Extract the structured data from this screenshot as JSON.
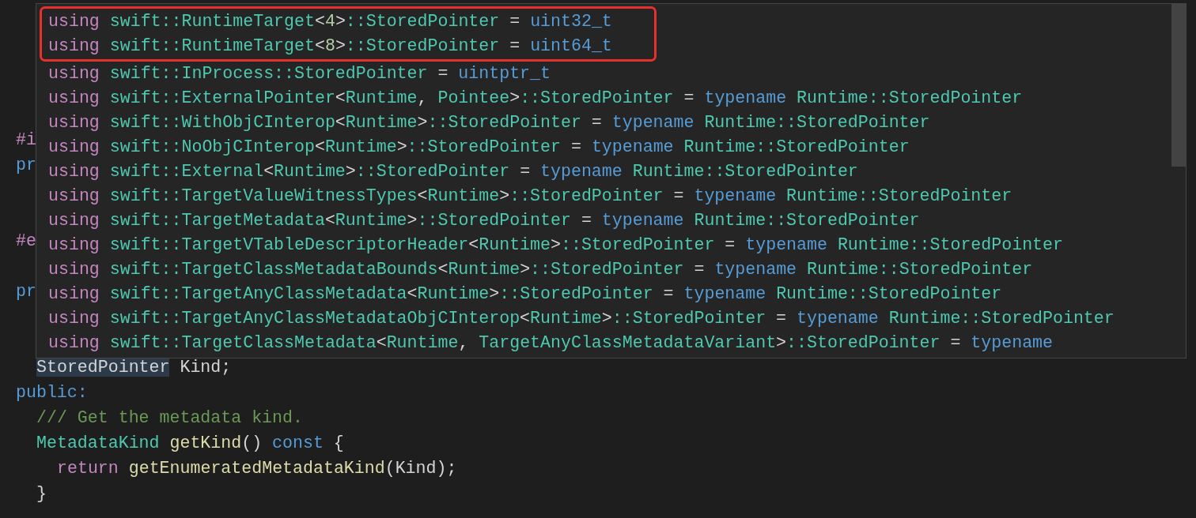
{
  "editor": {
    "lines": [
      {
        "kind": "blank"
      },
      {
        "kind": "blank"
      },
      {
        "kind": "blank"
      },
      {
        "kind": "blank"
      },
      {
        "kind": "blank"
      },
      {
        "kind": "outer",
        "tokens": [
          {
            "kind": "directive",
            "text": "#i"
          }
        ]
      },
      {
        "kind": "outer",
        "tokens": [
          {
            "kind": "storage",
            "text": "pr"
          }
        ]
      },
      {
        "kind": "blank"
      },
      {
        "kind": "blank"
      },
      {
        "kind": "outer",
        "tokens": [
          {
            "kind": "directive",
            "text": "#e"
          }
        ]
      },
      {
        "kind": "blank"
      },
      {
        "kind": "outer",
        "tokens": [
          {
            "kind": "storage",
            "text": "pr"
          }
        ]
      },
      {
        "kind": "blank"
      },
      {
        "kind": "blank"
      },
      {
        "kind": "inner",
        "tokens": [
          {
            "kind": "plain",
            "text": "StoredPointer",
            "highlighted": true
          },
          {
            "kind": "plain",
            "text": " Kind;"
          }
        ]
      },
      {
        "kind": "outer",
        "tokens": [
          {
            "kind": "storage",
            "text": "public:"
          }
        ]
      },
      {
        "kind": "inner",
        "tokens": [
          {
            "kind": "comment",
            "text": "/// Get the metadata kind."
          }
        ]
      },
      {
        "kind": "inner",
        "tokens": [
          {
            "kind": "type",
            "text": "MetadataKind"
          },
          {
            "kind": "function",
            "text": " getKind"
          },
          {
            "kind": "plain",
            "text": "() "
          },
          {
            "kind": "storage",
            "text": "const"
          },
          {
            "kind": "plain",
            "text": " {"
          }
        ]
      },
      {
        "kind": "deep",
        "tokens": [
          {
            "kind": "keyword",
            "text": "return"
          },
          {
            "kind": "function",
            "text": " getEnumeratedMetadataKind"
          },
          {
            "kind": "plain",
            "text": "(Kind);"
          }
        ]
      },
      {
        "kind": "inner",
        "tokens": [
          {
            "kind": "plain",
            "text": "}"
          }
        ]
      }
    ]
  },
  "popup": {
    "lines": [
      {
        "highlighted": true,
        "tokens": [
          {
            "kind": "keyword",
            "text": "using"
          },
          {
            "kind": "type",
            "text": " swift::RuntimeTarget"
          },
          {
            "kind": "plain",
            "text": "<"
          },
          {
            "kind": "number",
            "text": "4"
          },
          {
            "kind": "plain",
            "text": ">"
          },
          {
            "kind": "type",
            "text": "::StoredPointer"
          },
          {
            "kind": "plain",
            "text": " = "
          },
          {
            "kind": "storage",
            "text": "uint32_t"
          }
        ]
      },
      {
        "highlighted": true,
        "tokens": [
          {
            "kind": "keyword",
            "text": "using"
          },
          {
            "kind": "type",
            "text": " swift::RuntimeTarget"
          },
          {
            "kind": "plain",
            "text": "<"
          },
          {
            "kind": "number",
            "text": "8"
          },
          {
            "kind": "plain",
            "text": ">"
          },
          {
            "kind": "type",
            "text": "::StoredPointer"
          },
          {
            "kind": "plain",
            "text": " = "
          },
          {
            "kind": "storage",
            "text": "uint64_t"
          }
        ]
      },
      {
        "highlighted": false,
        "tokens": [
          {
            "kind": "keyword",
            "text": "using"
          },
          {
            "kind": "type",
            "text": " swift::InProcess::StoredPointer"
          },
          {
            "kind": "plain",
            "text": " = "
          },
          {
            "kind": "storage",
            "text": "uintptr_t"
          }
        ]
      },
      {
        "highlighted": false,
        "tokens": [
          {
            "kind": "keyword",
            "text": "using"
          },
          {
            "kind": "type",
            "text": " swift::ExternalPointer"
          },
          {
            "kind": "plain",
            "text": "<"
          },
          {
            "kind": "type",
            "text": "Runtime"
          },
          {
            "kind": "plain",
            "text": ", "
          },
          {
            "kind": "type",
            "text": "Pointee"
          },
          {
            "kind": "plain",
            "text": ">"
          },
          {
            "kind": "type",
            "text": "::StoredPointer"
          },
          {
            "kind": "plain",
            "text": " = "
          },
          {
            "kind": "storage",
            "text": "typename"
          },
          {
            "kind": "type",
            "text": " Runtime::StoredPointer"
          }
        ]
      },
      {
        "highlighted": false,
        "tokens": [
          {
            "kind": "keyword",
            "text": "using"
          },
          {
            "kind": "type",
            "text": " swift::WithObjCInterop"
          },
          {
            "kind": "plain",
            "text": "<"
          },
          {
            "kind": "type",
            "text": "Runtime"
          },
          {
            "kind": "plain",
            "text": ">"
          },
          {
            "kind": "type",
            "text": "::StoredPointer"
          },
          {
            "kind": "plain",
            "text": " = "
          },
          {
            "kind": "storage",
            "text": "typename"
          },
          {
            "kind": "type",
            "text": " Runtime::StoredPointer"
          }
        ]
      },
      {
        "highlighted": false,
        "tokens": [
          {
            "kind": "keyword",
            "text": "using"
          },
          {
            "kind": "type",
            "text": " swift::NoObjCInterop"
          },
          {
            "kind": "plain",
            "text": "<"
          },
          {
            "kind": "type",
            "text": "Runtime"
          },
          {
            "kind": "plain",
            "text": ">"
          },
          {
            "kind": "type",
            "text": "::StoredPointer"
          },
          {
            "kind": "plain",
            "text": " = "
          },
          {
            "kind": "storage",
            "text": "typename"
          },
          {
            "kind": "type",
            "text": " Runtime::StoredPointer"
          }
        ]
      },
      {
        "highlighted": false,
        "tokens": [
          {
            "kind": "keyword",
            "text": "using"
          },
          {
            "kind": "type",
            "text": " swift::External"
          },
          {
            "kind": "plain",
            "text": "<"
          },
          {
            "kind": "type",
            "text": "Runtime"
          },
          {
            "kind": "plain",
            "text": ">"
          },
          {
            "kind": "type",
            "text": "::StoredPointer"
          },
          {
            "kind": "plain",
            "text": " = "
          },
          {
            "kind": "storage",
            "text": "typename"
          },
          {
            "kind": "type",
            "text": " Runtime::StoredPointer"
          }
        ]
      },
      {
        "highlighted": false,
        "tokens": [
          {
            "kind": "keyword",
            "text": "using"
          },
          {
            "kind": "type",
            "text": " swift::TargetValueWitnessTypes"
          },
          {
            "kind": "plain",
            "text": "<"
          },
          {
            "kind": "type",
            "text": "Runtime"
          },
          {
            "kind": "plain",
            "text": ">"
          },
          {
            "kind": "type",
            "text": "::StoredPointer"
          },
          {
            "kind": "plain",
            "text": " = "
          },
          {
            "kind": "storage",
            "text": "typename"
          },
          {
            "kind": "type",
            "text": " Runtime::StoredPointer"
          }
        ]
      },
      {
        "highlighted": false,
        "tokens": [
          {
            "kind": "keyword",
            "text": "using"
          },
          {
            "kind": "type",
            "text": " swift::TargetMetadata"
          },
          {
            "kind": "plain",
            "text": "<"
          },
          {
            "kind": "type",
            "text": "Runtime"
          },
          {
            "kind": "plain",
            "text": ">"
          },
          {
            "kind": "type",
            "text": "::StoredPointer"
          },
          {
            "kind": "plain",
            "text": " = "
          },
          {
            "kind": "storage",
            "text": "typename"
          },
          {
            "kind": "type",
            "text": " Runtime::StoredPointer"
          }
        ]
      },
      {
        "highlighted": false,
        "tokens": [
          {
            "kind": "keyword",
            "text": "using"
          },
          {
            "kind": "type",
            "text": " swift::TargetVTableDescriptorHeader"
          },
          {
            "kind": "plain",
            "text": "<"
          },
          {
            "kind": "type",
            "text": "Runtime"
          },
          {
            "kind": "plain",
            "text": ">"
          },
          {
            "kind": "type",
            "text": "::StoredPointer"
          },
          {
            "kind": "plain",
            "text": " = "
          },
          {
            "kind": "storage",
            "text": "typename"
          },
          {
            "kind": "type",
            "text": " Runtime::StoredPointer"
          }
        ]
      },
      {
        "highlighted": false,
        "tokens": [
          {
            "kind": "keyword",
            "text": "using"
          },
          {
            "kind": "type",
            "text": " swift::TargetClassMetadataBounds"
          },
          {
            "kind": "plain",
            "text": "<"
          },
          {
            "kind": "type",
            "text": "Runtime"
          },
          {
            "kind": "plain",
            "text": ">"
          },
          {
            "kind": "type",
            "text": "::StoredPointer"
          },
          {
            "kind": "plain",
            "text": " = "
          },
          {
            "kind": "storage",
            "text": "typename"
          },
          {
            "kind": "type",
            "text": " Runtime::StoredPointer"
          }
        ]
      },
      {
        "highlighted": false,
        "tokens": [
          {
            "kind": "keyword",
            "text": "using"
          },
          {
            "kind": "type",
            "text": " swift::TargetAnyClassMetadata"
          },
          {
            "kind": "plain",
            "text": "<"
          },
          {
            "kind": "type",
            "text": "Runtime"
          },
          {
            "kind": "plain",
            "text": ">"
          },
          {
            "kind": "type",
            "text": "::StoredPointer"
          },
          {
            "kind": "plain",
            "text": " = "
          },
          {
            "kind": "storage",
            "text": "typename"
          },
          {
            "kind": "type",
            "text": " Runtime::StoredPointer"
          }
        ]
      },
      {
        "highlighted": false,
        "tokens": [
          {
            "kind": "keyword",
            "text": "using"
          },
          {
            "kind": "type",
            "text": " swift::TargetAnyClassMetadataObjCInterop"
          },
          {
            "kind": "plain",
            "text": "<"
          },
          {
            "kind": "type",
            "text": "Runtime"
          },
          {
            "kind": "plain",
            "text": ">"
          },
          {
            "kind": "type",
            "text": "::StoredPointer"
          },
          {
            "kind": "plain",
            "text": " = "
          },
          {
            "kind": "storage",
            "text": "typename"
          },
          {
            "kind": "type",
            "text": " Runtime::StoredPointer"
          }
        ]
      },
      {
        "highlighted": false,
        "tokens": [
          {
            "kind": "keyword",
            "text": "using"
          },
          {
            "kind": "type",
            "text": " swift::TargetClassMetadata"
          },
          {
            "kind": "plain",
            "text": "<"
          },
          {
            "kind": "type",
            "text": "Runtime"
          },
          {
            "kind": "plain",
            "text": ", "
          },
          {
            "kind": "type",
            "text": "TargetAnyClassMetadataVariant"
          },
          {
            "kind": "plain",
            "text": ">"
          },
          {
            "kind": "type",
            "text": "::StoredPointer"
          },
          {
            "kind": "plain",
            "text": " = "
          },
          {
            "kind": "storage",
            "text": "typename"
          }
        ]
      }
    ]
  }
}
